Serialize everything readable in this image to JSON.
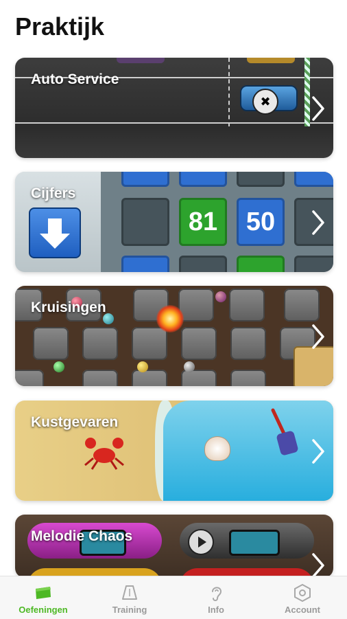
{
  "page": {
    "title": "Praktijk"
  },
  "exercises": [
    {
      "label": "Auto Service"
    },
    {
      "label": "Cijfers",
      "tiles": [
        "81",
        "50"
      ]
    },
    {
      "label": "Kruisingen"
    },
    {
      "label": "Kustgevaren"
    },
    {
      "label": "Melodie Chaos"
    }
  ],
  "tabs": [
    {
      "label": "Oefeningen",
      "icon": "flag-icon",
      "active": true
    },
    {
      "label": "Training",
      "icon": "bell-icon",
      "active": false
    },
    {
      "label": "Info",
      "icon": "ear-icon",
      "active": false
    },
    {
      "label": "Account",
      "icon": "hexagon-icon",
      "active": false
    }
  ],
  "colors": {
    "accent": "#4db824"
  }
}
